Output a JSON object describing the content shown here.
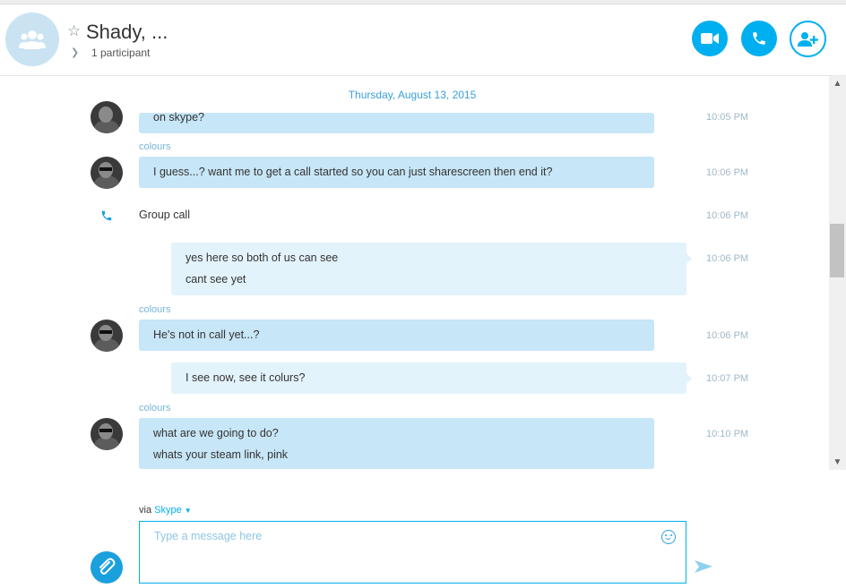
{
  "header": {
    "title": "Shady, ...",
    "participants": "1 participant",
    "buttons": [
      "video-call",
      "audio-call",
      "add-participant"
    ]
  },
  "conversation": {
    "date": "Thursday, August 13, 2015",
    "messages": [
      {
        "kind": "in",
        "sender": "",
        "lines": [
          "on skype?"
        ],
        "time": "10:05 PM"
      },
      {
        "kind": "in",
        "sender": "colours",
        "lines": [
          "I guess...? want me to get a call started so you can just sharescreen then end it?"
        ],
        "time": "10:06 PM"
      },
      {
        "kind": "call",
        "text": "Group call",
        "time": "10:06 PM"
      },
      {
        "kind": "out",
        "lines": [
          "yes here so both of us can see",
          "cant see yet"
        ],
        "time": "10:06 PM"
      },
      {
        "kind": "in",
        "sender": "colours",
        "lines": [
          "He's not in call yet...?"
        ],
        "time": "10:06 PM"
      },
      {
        "kind": "out",
        "lines": [
          "I see now, see it colurs?"
        ],
        "time": "10:07 PM"
      },
      {
        "kind": "in",
        "sender": "colours",
        "lines": [
          "what are we going to do?",
          "whats your steam link, pink"
        ],
        "time": "10:10 PM"
      }
    ]
  },
  "composer": {
    "via_label": "via",
    "via_service": "Skype",
    "placeholder": "Type a message here"
  },
  "colors": {
    "accent": "#00aff0",
    "incoming_bubble": "#c7e6f7",
    "outgoing_bubble": "#e3f3fb"
  }
}
